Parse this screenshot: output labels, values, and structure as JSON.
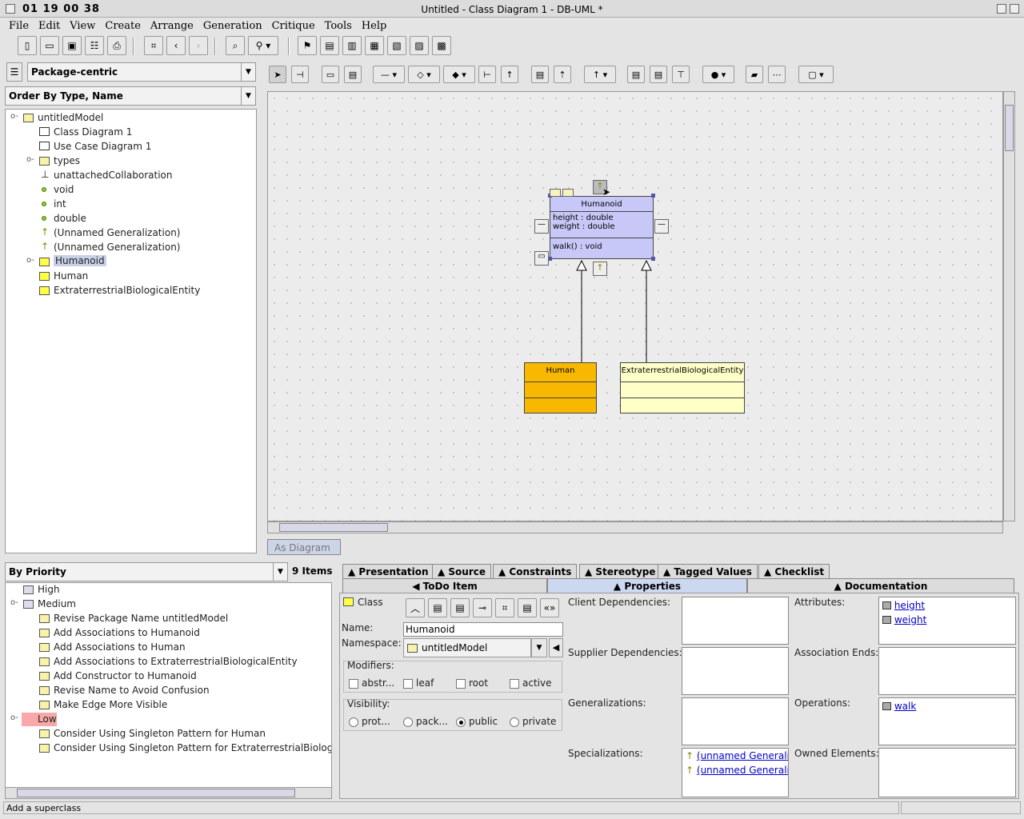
{
  "window": {
    "clock": "01 19 00 38",
    "title": "Untitled - Class Diagram 1 - DB-UML *"
  },
  "menu": [
    "File",
    "Edit",
    "View",
    "Create",
    "Arrange",
    "Generation",
    "Critique",
    "Tools",
    "Help"
  ],
  "explorer": {
    "perspective": "Package-centric",
    "order": "Order By Type, Name",
    "items": [
      "untitledModel",
      "Class Diagram 1",
      "Use Case Diagram 1",
      "types",
      "unattachedCollaboration",
      "void",
      "int",
      "double",
      "(Unnamed Generalization)",
      "(Unnamed Generalization)",
      "Humanoid",
      "Human",
      "ExtraterrestrialBiologicalEntity"
    ]
  },
  "diagram": {
    "humanoid": {
      "name": "Humanoid",
      "attrs": [
        "height : double",
        "weight : double"
      ],
      "ops": [
        "walk() : void"
      ]
    },
    "human": {
      "name": "Human"
    },
    "ete": {
      "name": "ExtraterrestrialBiologicalEntity"
    },
    "tab": "As Diagram"
  },
  "todo": {
    "sort": "By Priority",
    "count": "9 Items",
    "groups": [
      "High",
      "Medium",
      "Low"
    ],
    "medium_items": [
      "Revise Package Name untitledModel",
      "Add Associations to Humanoid",
      "Add Associations to Human",
      "Add Associations to ExtraterrestrialBiologicalEntity",
      "Add Constructor to Humanoid",
      "Revise Name to Avoid Confusion",
      "Make Edge More Visible"
    ],
    "low_items": [
      "Consider Using Singleton Pattern for Human",
      "Consider Using Singleton Pattern for ExtraterrestrialBiological"
    ]
  },
  "details": {
    "tabs_top": [
      "Presentation",
      "Source",
      "Constraints",
      "Stereotype",
      "Tagged Values",
      "Checklist"
    ],
    "tabs_bottom": [
      "ToDo Item",
      "Properties",
      "Documentation"
    ],
    "kind": "Class",
    "name_label": "Name:",
    "name_value": "Humanoid",
    "ns_label": "Namespace:",
    "ns_value": "untitledModel",
    "modifiers_label": "Modifiers:",
    "modifiers": [
      "abstr...",
      "leaf",
      "root",
      "active"
    ],
    "visibility_label": "Visibility:",
    "visibility": [
      "prot...",
      "pack...",
      "public",
      "private"
    ],
    "client_deps": "Client Dependencies:",
    "supplier_deps": "Supplier Dependencies:",
    "generalizations": "Generalizations:",
    "specializations": "Specializations:",
    "spec_items": [
      "(unnamed Generaliz",
      "(unnamed Generaliz"
    ],
    "attributes": "Attributes:",
    "attr_items": [
      "height",
      "weight"
    ],
    "assoc_ends": "Association Ends:",
    "operations": "Operations:",
    "op_items": [
      "walk"
    ],
    "owned": "Owned Elements:"
  },
  "status": "Add a superclass"
}
